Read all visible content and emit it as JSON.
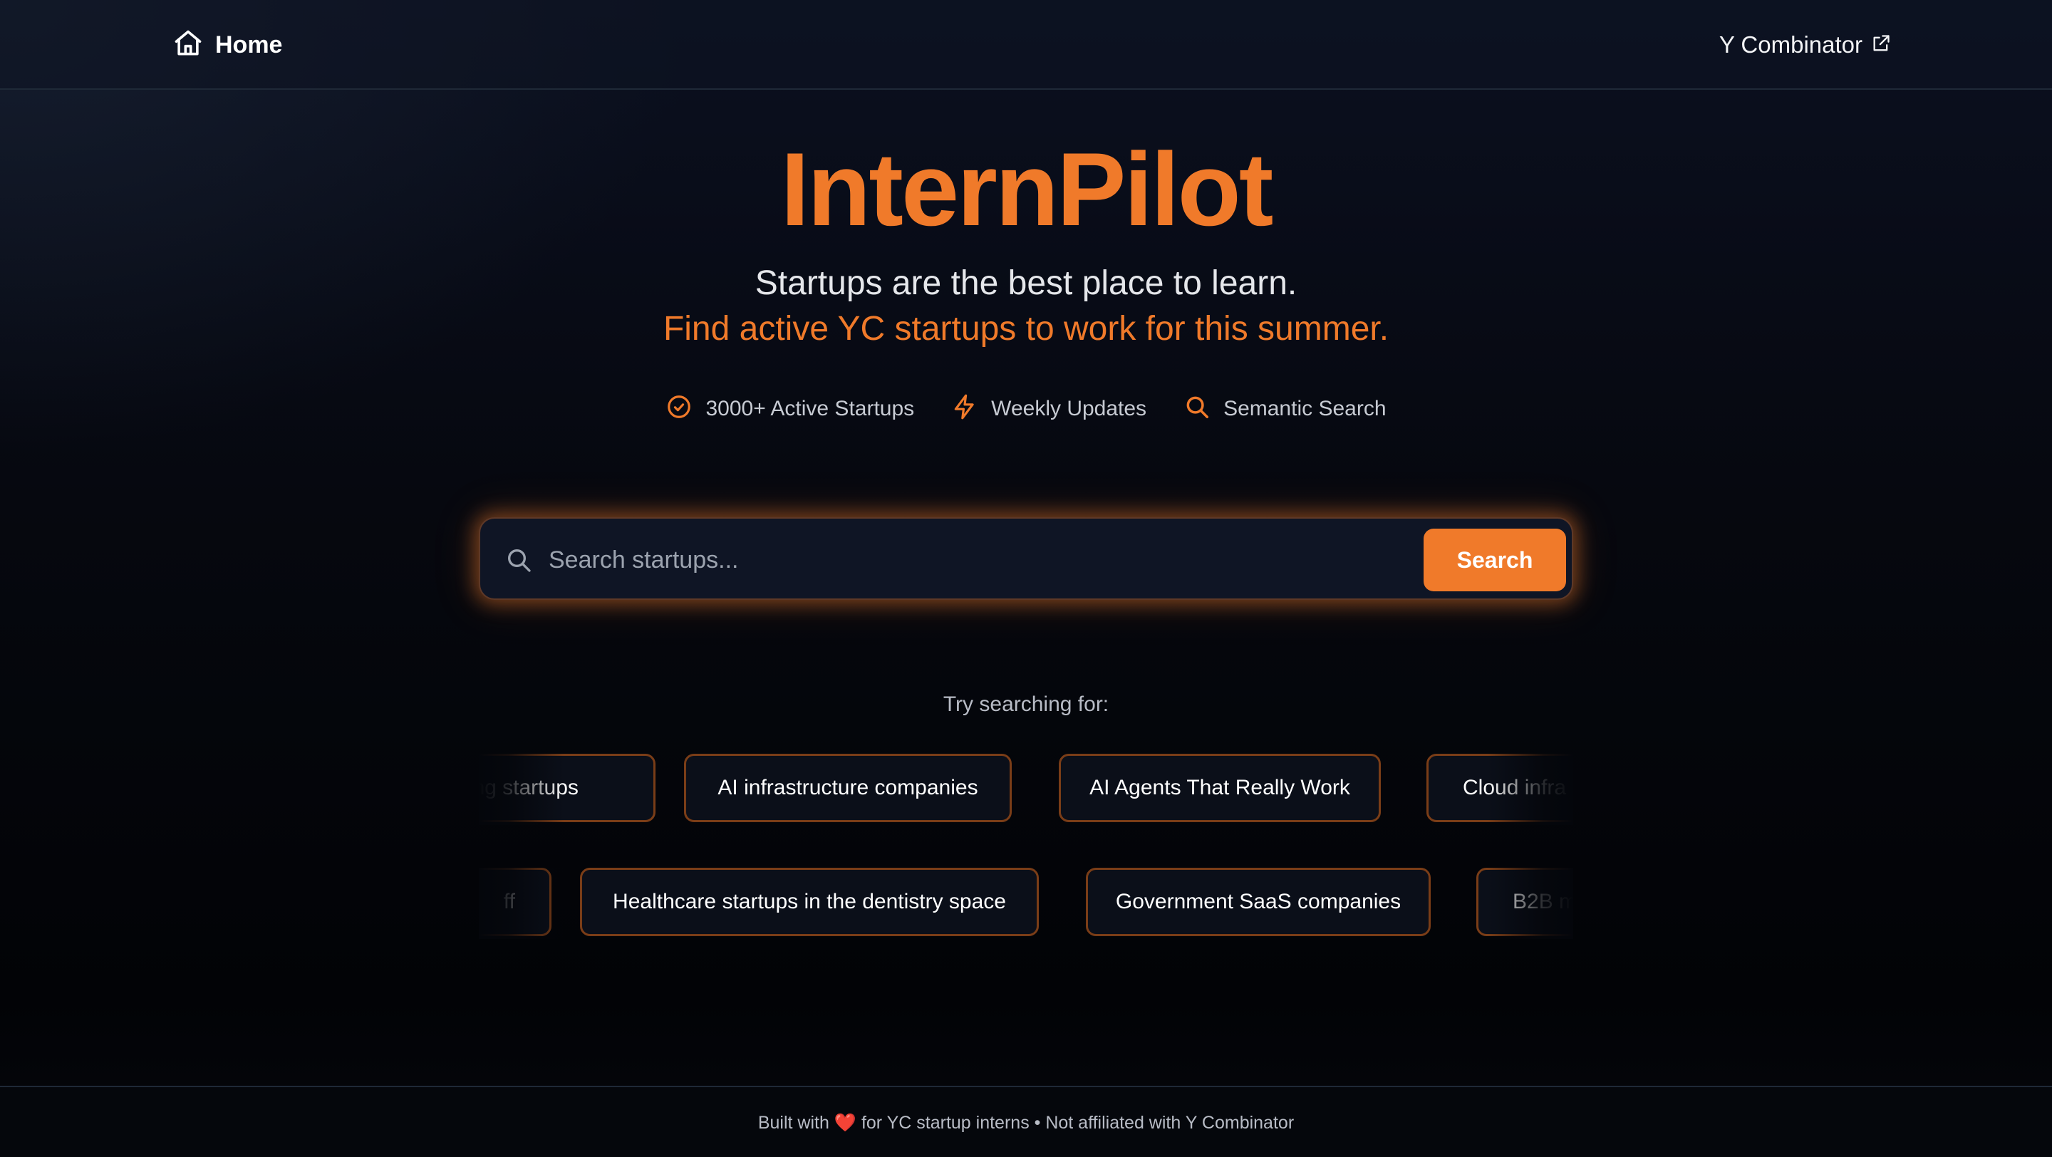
{
  "header": {
    "home_label": "Home",
    "external_label": "Y Combinator"
  },
  "hero": {
    "title": "InternPilot",
    "subtitle": "Startups are the best place to learn.",
    "tagline": "Find active YC startups to work for this summer.",
    "features": [
      {
        "icon": "check-circle-icon",
        "label": "3000+ Active Startups"
      },
      {
        "icon": "lightning-icon",
        "label": "Weekly Updates"
      },
      {
        "icon": "search-icon",
        "label": "Semantic Search"
      }
    ]
  },
  "search": {
    "placeholder": "Search startups...",
    "value": "",
    "button_label": "Search"
  },
  "suggestions": {
    "label": "Try searching for:",
    "row1": [
      "ding startups",
      "AI infrastructure companies",
      "AI Agents That Really Work",
      "Cloud infra"
    ],
    "row2": [
      "ff",
      "Healthcare startups in the dentistry space",
      "Government SaaS companies",
      "B2B m"
    ]
  },
  "footer": {
    "built_with": "Built with",
    "heart": "❤️",
    "rest": "for YC startup interns • Not affiliated with Y Combinator"
  },
  "colors": {
    "accent": "#f07a2a",
    "background": "#05070c",
    "chip_border": "#7a3d17"
  }
}
